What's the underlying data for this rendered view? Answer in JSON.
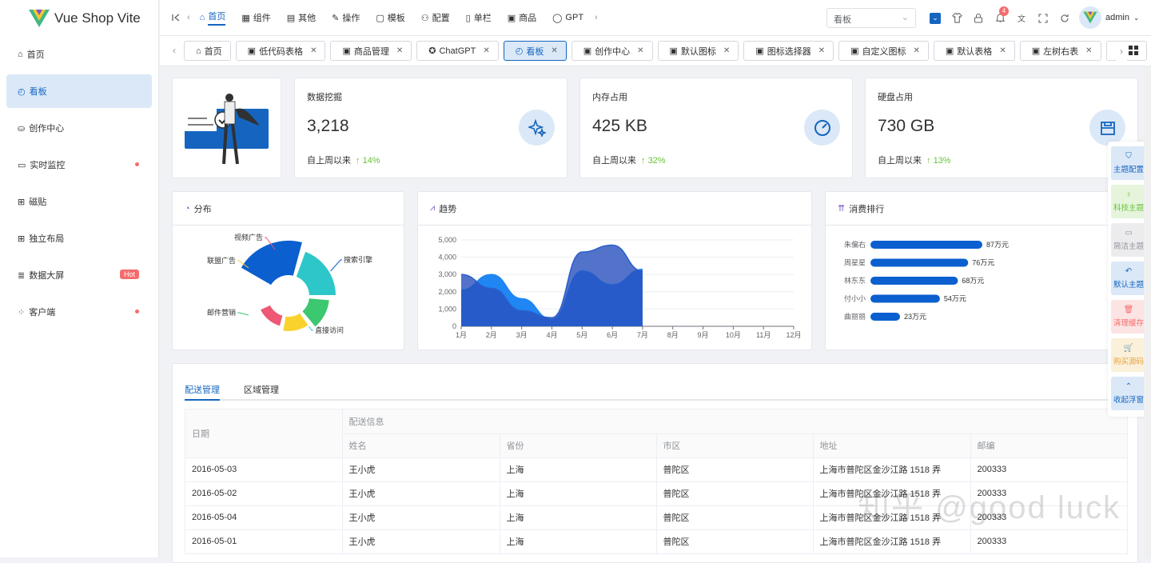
{
  "app": {
    "name": "Vue Shop Vite"
  },
  "sidebar": {
    "items": [
      {
        "icon": "home-icon",
        "label": "首页"
      },
      {
        "icon": "dashboard-icon",
        "label": "看板"
      },
      {
        "icon": "creator-icon",
        "label": "创作中心"
      },
      {
        "icon": "monitor-icon",
        "label": "实时监控"
      },
      {
        "icon": "grid-icon",
        "label": "磁贴"
      },
      {
        "icon": "layout-icon",
        "label": "独立布局"
      },
      {
        "icon": "database-icon",
        "label": "数据大屏",
        "badge": "Hot"
      },
      {
        "icon": "client-icon",
        "label": "客户端"
      }
    ]
  },
  "topnav": {
    "items": [
      {
        "icon": "home-icon",
        "label": "首页"
      },
      {
        "icon": "component-icon",
        "label": "组件"
      },
      {
        "icon": "other-icon",
        "label": "其他"
      },
      {
        "icon": "operate-icon",
        "label": "操作"
      },
      {
        "icon": "template-icon",
        "label": "模板"
      },
      {
        "icon": "config-icon",
        "label": "配置"
      },
      {
        "icon": "column-icon",
        "label": "单栏"
      },
      {
        "icon": "goods-icon",
        "label": "商品"
      },
      {
        "icon": "gpt-icon",
        "label": "GPT"
      }
    ]
  },
  "header": {
    "select_value": "看板",
    "notification_count": "4",
    "user": "admin"
  },
  "tabs": [
    "首页",
    "低代码表格",
    "商品管理",
    "ChatGPT",
    "看板",
    "创作中心",
    "默认图标",
    "图标选择器",
    "自定义图标",
    "默认表格",
    "左树右表",
    "…"
  ],
  "stats": [
    {
      "label": "数据挖掘",
      "value": "3,218",
      "since": "自上周以来",
      "pct": "14%",
      "icon": "sparkle-icon"
    },
    {
      "label": "内存占用",
      "value": "425 KB",
      "since": "自上周以来",
      "pct": "32%",
      "icon": "gauge-icon"
    },
    {
      "label": "硬盘占用",
      "value": "730 GB",
      "since": "自上周以来",
      "pct": "13%",
      "icon": "disk-icon"
    }
  ],
  "panels": {
    "distribution": "分布",
    "trend": "趋势",
    "ranking": "消费排行"
  },
  "chart_data": [
    {
      "type": "pie",
      "title": "分布",
      "categories": [
        "搜索引擎",
        "直接访问",
        "邮件营销",
        "联盟广告",
        "视频广告"
      ],
      "colors": [
        "#0b5fcf",
        "#2ec7c9",
        "#3cc771",
        "#f9d22e",
        "#ee5875"
      ],
      "values": [
        335,
        310,
        234,
        135,
        148
      ]
    },
    {
      "type": "area",
      "title": "趋势",
      "x": [
        "1月",
        "2月",
        "3月",
        "4月",
        "5月",
        "6月",
        "7月",
        "8月",
        "9月",
        "10月",
        "11月",
        "12月"
      ],
      "ylim": [
        0,
        5000
      ],
      "yticks": [
        0,
        1000,
        2000,
        3000,
        4000,
        5000
      ],
      "yticklabels": [
        "0",
        "1,000",
        "2,000",
        "3,000",
        "4,000",
        "5,000"
      ],
      "series": [
        {
          "values": [
            2100,
            3000,
            1600,
            400,
            3200,
            2400,
            3300
          ]
        },
        {
          "values": [
            3000,
            2200,
            900,
            500,
            4300,
            4700,
            3200
          ]
        }
      ]
    },
    {
      "type": "bar",
      "title": "消费排行",
      "categories": [
        "朱偏右",
        "周星星",
        "林东东",
        "付小小",
        "曲丽丽"
      ],
      "values": [
        87,
        76,
        68,
        54,
        23
      ],
      "labels": [
        "87万元",
        "76万元",
        "68万元",
        "54万元",
        "23万元"
      ]
    }
  ],
  "table": {
    "tabs": [
      "配送管理",
      "区域管理"
    ],
    "group_header": "配送信息",
    "columns": [
      "日期",
      "姓名",
      "省份",
      "市区",
      "地址",
      "邮编"
    ],
    "rows": [
      [
        "2016-05-03",
        "王小虎",
        "上海",
        "普陀区",
        "上海市普陀区金沙江路 1518 弄",
        "200333"
      ],
      [
        "2016-05-02",
        "王小虎",
        "上海",
        "普陀区",
        "上海市普陀区金沙江路 1518 弄",
        "200333"
      ],
      [
        "2016-05-04",
        "王小虎",
        "上海",
        "普陀区",
        "上海市普陀区金沙江路 1518 弄",
        "200333"
      ],
      [
        "2016-05-01",
        "王小虎",
        "上海",
        "普陀区",
        "上海市普陀区金沙江路 1518 弄",
        "200333"
      ]
    ]
  },
  "float_panel": [
    {
      "label": "主题配置",
      "color": "#1565c0",
      "bg": "#dbe8f7"
    },
    {
      "label": "科技主题",
      "color": "#67c23a",
      "bg": "#e6f4dc"
    },
    {
      "label": "简洁主题",
      "color": "#909399",
      "bg": "#ececee"
    },
    {
      "label": "默认主题",
      "color": "#1565c0",
      "bg": "#dbe8f7"
    },
    {
      "label": "清理缓存",
      "color": "#f56c6c",
      "bg": "#fde4e4"
    },
    {
      "label": "购买源码",
      "color": "#e6a23c",
      "bg": "#fbf0d9"
    },
    {
      "label": "收起浮窗",
      "color": "#1565c0",
      "bg": "#dbe8f7"
    }
  ],
  "watermark": "知乎 @good luck"
}
